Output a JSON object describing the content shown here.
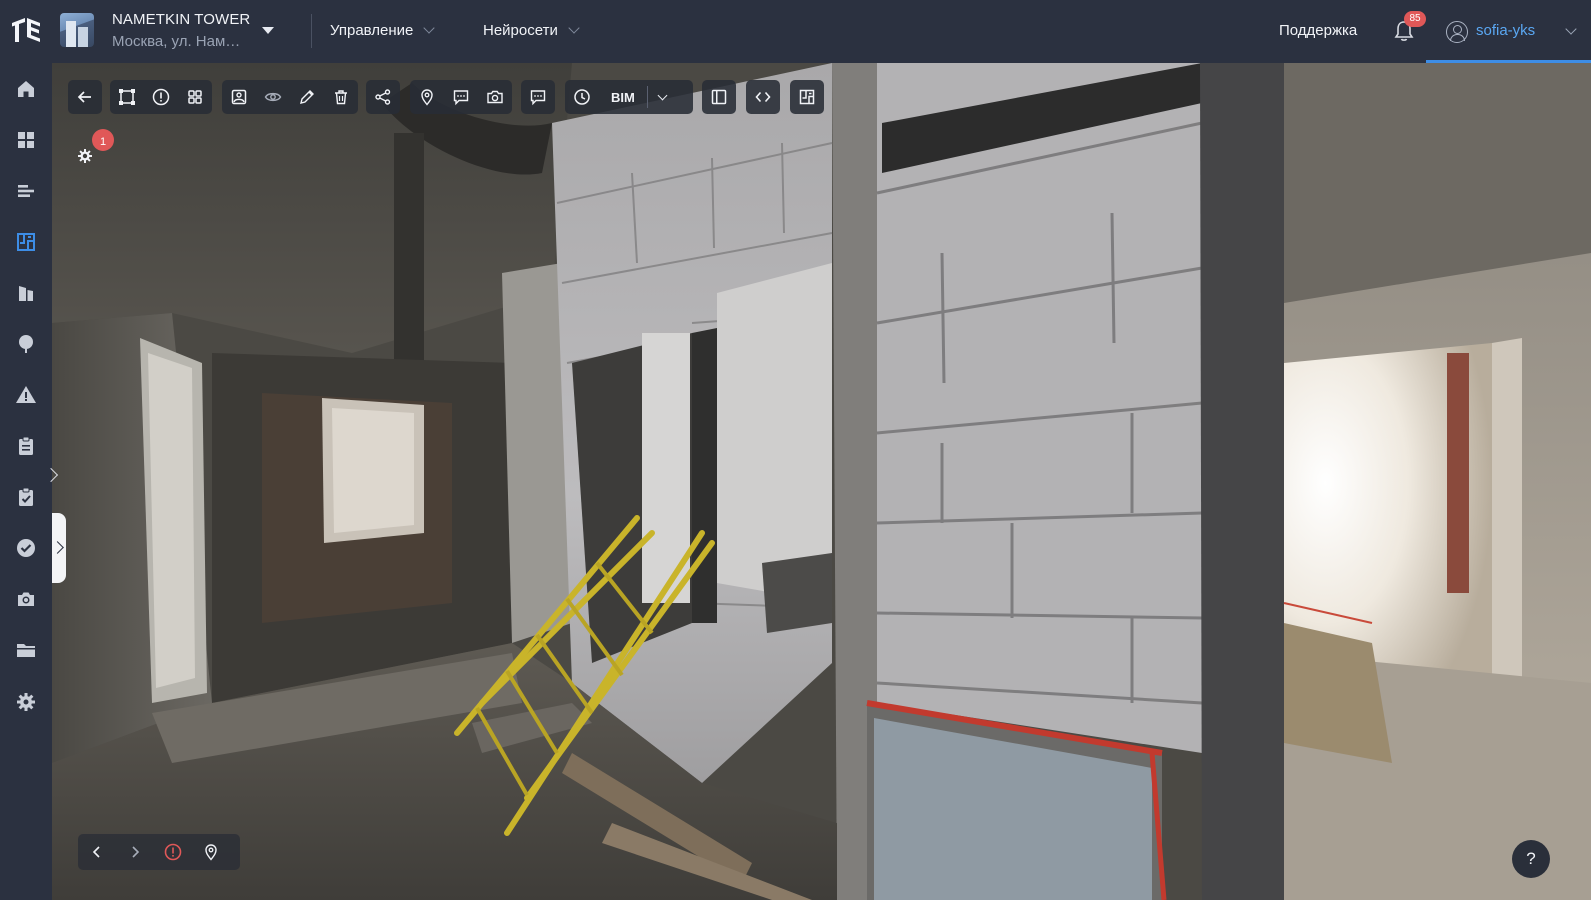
{
  "header": {
    "project_name": "NAMETKIN TOWER",
    "project_address": "Москва, ул. Нам…",
    "menus": [
      {
        "label": "Управление"
      },
      {
        "label": "Нейросети"
      }
    ],
    "support_label": "Поддержка",
    "notifications_count": "85",
    "username": "sofia-yks"
  },
  "sidebar": {
    "items": [
      {
        "icon": "home-icon",
        "active": false
      },
      {
        "icon": "dashboard-icon",
        "active": false
      },
      {
        "icon": "gantt-icon",
        "active": false
      },
      {
        "icon": "floorplan-icon",
        "active": true
      },
      {
        "icon": "building-icon",
        "active": false
      },
      {
        "icon": "tree-icon",
        "active": false
      },
      {
        "icon": "warning-icon",
        "active": false
      },
      {
        "icon": "clipboard-icon",
        "active": false
      },
      {
        "icon": "checklist-icon",
        "active": false
      },
      {
        "icon": "check-circle-icon",
        "active": false
      },
      {
        "icon": "camera-icon",
        "active": false
      },
      {
        "icon": "folder-icon",
        "active": false
      },
      {
        "icon": "settings-icon",
        "active": false
      }
    ]
  },
  "toolbar": {
    "bim_label": "BIM"
  },
  "viewer": {
    "settings_badge": "1",
    "help_label": "?"
  },
  "colors": {
    "background": "#2b3140",
    "accent": "#3d8de6",
    "badge": "#e05858"
  }
}
